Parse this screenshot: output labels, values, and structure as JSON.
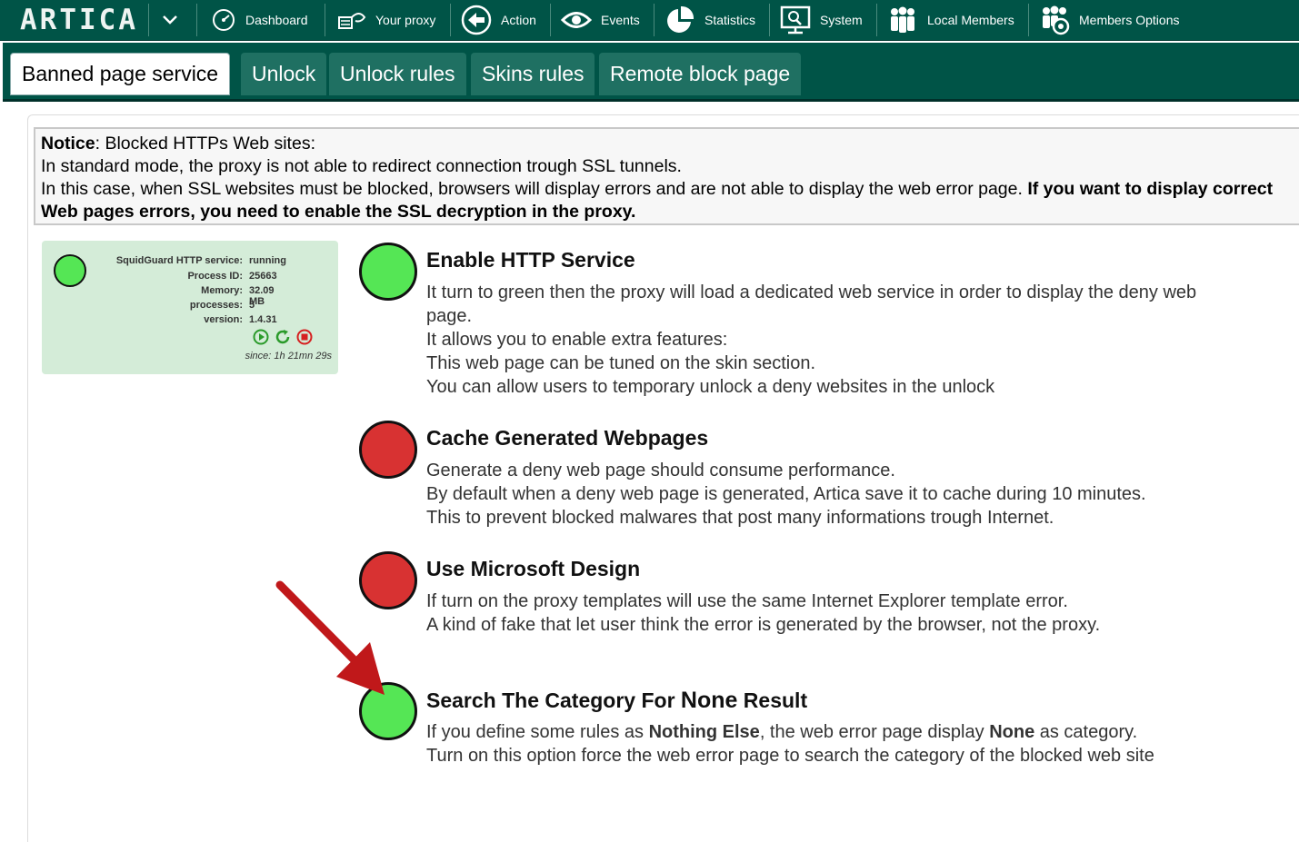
{
  "nav": {
    "logo": "ARTICA",
    "items": [
      {
        "label": "Dashboard",
        "icon": "dashboard-icon"
      },
      {
        "label": "Your proxy",
        "icon": "proxy-icon"
      },
      {
        "label": "Action",
        "icon": "action-icon"
      },
      {
        "label": "Events",
        "icon": "eye-icon"
      },
      {
        "label": "Statistics",
        "icon": "pie-chart-icon"
      },
      {
        "label": "System",
        "icon": "monitor-icon"
      },
      {
        "label": "Local Members",
        "icon": "members-icon"
      },
      {
        "label": "Members Options",
        "icon": "members-options-icon"
      }
    ]
  },
  "tabs": [
    {
      "label": "Banned page service",
      "active": true
    },
    {
      "label": "Unlock",
      "active": false
    },
    {
      "label": "Unlock rules",
      "active": false
    },
    {
      "label": "Skins rules",
      "active": false
    },
    {
      "label": "Remote block page",
      "active": false
    }
  ],
  "notice": {
    "label": "Notice",
    "line1": ": Blocked HTTPs Web sites:",
    "line2": "In standard mode, the proxy is not able to redirect connection trough SSL tunnels.",
    "line3_plain": "In this case, when SSL websites must be blocked, browsers will display errors and are not able to display the web error page. ",
    "line3_bold": "If you want to display correct",
    "line4_bold": "Web pages errors, you need to enable the SSL decryption in the proxy."
  },
  "status": {
    "rows": [
      {
        "key": "SquidGuard HTTP service:",
        "value": "running"
      },
      {
        "key": "Process ID:",
        "value": "25663"
      },
      {
        "key": "Memory:",
        "value": "32.09 MB"
      },
      {
        "key": "processes:",
        "value": "5"
      },
      {
        "key": "version:",
        "value": "1.4.31"
      }
    ],
    "since": "since: 1h 21mn 29s",
    "led_color": "#55e655"
  },
  "features": [
    {
      "title": "Enable HTTP Service",
      "state": "on",
      "lines": [
        "It turn to green then the proxy will load a dedicated web service in order to display the deny web",
        "page.",
        "It allows you to enable extra features:",
        "This web page can be tuned on the skin section.",
        "You can allow users to temporary unlock a deny websites in the unlock"
      ]
    },
    {
      "title": "Cache Generated Webpages",
      "state": "off",
      "lines": [
        "Generate a deny web page should consume performance.",
        "By default when a deny web page is generated, Artica save it to cache during 10 minutes.",
        "This to prevent blocked malwares that post many informations trough Internet."
      ]
    },
    {
      "title": "Use Microsoft Design",
      "state": "off",
      "lines": [
        "If turn on the proxy templates will use the same Internet Explorer template error.",
        "A kind of fake that let user think the error is generated by the browser, not the proxy."
      ]
    },
    {
      "title_a": "Search The Category For ",
      "title_b": "None",
      "title_c": " Result",
      "state": "on",
      "line1_a": "If you define some rules as ",
      "line1_b": "Nothing Else",
      "line1_c": ", the web error page display ",
      "line1_d": "None",
      "line1_e": " as category.",
      "line2": "Turn on this option force the web error page to search the category of the blocked web site"
    }
  ],
  "colors": {
    "header_bg": "#005447",
    "on": "#55e655",
    "off": "#d83232",
    "arrow": "#c0181a"
  }
}
